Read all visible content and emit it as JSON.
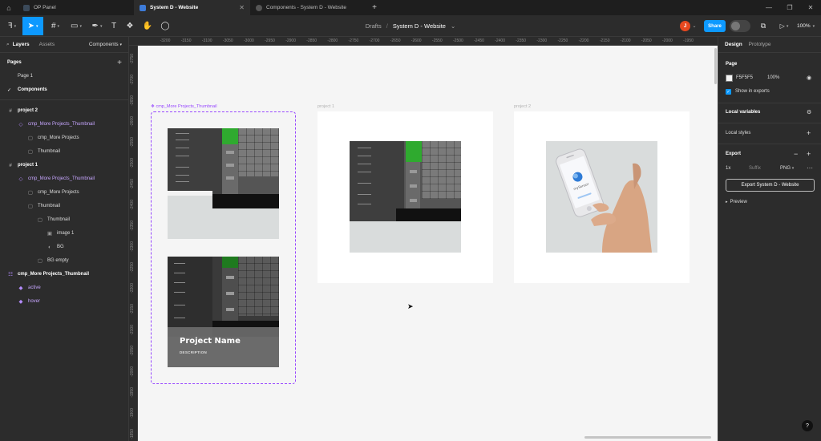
{
  "tabs": [
    {
      "label": "OP Panel",
      "active": false
    },
    {
      "label": "System D - Website",
      "active": true
    },
    {
      "label": "Components - System D - Website",
      "active": false
    }
  ],
  "window_controls": {
    "minimize": "—",
    "restore": "❐",
    "close": "✕"
  },
  "toolbar": {
    "breadcrumb_parent": "Drafts",
    "breadcrumb_sep": "/",
    "file_name": "System D - Website",
    "avatar_initial": "J",
    "share_label": "Share",
    "zoom_level": "100%"
  },
  "left_panel": {
    "tab_layers": "Layers",
    "tab_assets": "Assets",
    "components_dropdown": "Components",
    "pages_heading": "Pages",
    "add_icon": "+",
    "pages": [
      "Page 1",
      "Components"
    ],
    "current_page_check": "✓",
    "layers": [
      {
        "label": "project 2",
        "icon": "#",
        "type": "frame"
      },
      {
        "label": "cmp_More Projects_Thumbnail",
        "icon": "◇",
        "type": "instance"
      },
      {
        "label": "cmp_More Projects",
        "icon": "▢",
        "type": "group"
      },
      {
        "label": "Thumbnail",
        "icon": "▢",
        "type": "group"
      },
      {
        "label": "project 1",
        "icon": "#",
        "type": "frame"
      },
      {
        "label": "cmp_More Projects_Thumbnail",
        "icon": "◇",
        "type": "instance"
      },
      {
        "label": "cmp_More Projects",
        "icon": "▢",
        "type": "group"
      },
      {
        "label": "Thumbnail",
        "icon": "▢",
        "type": "group"
      },
      {
        "label": "Thumbnail",
        "icon": "▢",
        "type": "group"
      },
      {
        "label": "image 1",
        "icon": "▣",
        "type": "image"
      },
      {
        "label": "BG",
        "icon": "◐",
        "type": "shape"
      },
      {
        "label": "BG empty",
        "icon": "▢",
        "type": "group"
      },
      {
        "label": "cmp_More Projects_Thumbnail",
        "icon": "☷",
        "type": "component-set"
      },
      {
        "label": "active",
        "icon": "◆",
        "type": "variant"
      },
      {
        "label": "hover",
        "icon": "◆",
        "type": "variant"
      }
    ]
  },
  "canvas": {
    "ruler_x": [
      "-3200",
      "-3150",
      "-3100",
      "-3050",
      "-3000",
      "-2950",
      "-2900",
      "-2850",
      "-2800",
      "-2750",
      "-2700",
      "-2650",
      "-2600",
      "-2550",
      "-2500",
      "-2450",
      "-2400",
      "-2350",
      "-2300",
      "-2250",
      "-2200",
      "-2150",
      "-2100",
      "-2050",
      "-2000",
      "-1950"
    ],
    "ruler_y": [
      "-2750",
      "-2700",
      "-2650",
      "-2600",
      "-2550",
      "-2500",
      "-2450",
      "-2400",
      "-2350",
      "-2300",
      "-2250",
      "-2200",
      "-2150",
      "-2100",
      "-2050",
      "-2000",
      "-1950",
      "-1900",
      "-1850"
    ],
    "component_set_label": "cmp_More Projects_Thumbnail",
    "frame_project1_label": "project 1",
    "frame_project2_label": "project 2",
    "project_name": "Project Name",
    "project_description": "DESCRIPTION",
    "phone_brand": "mySensor"
  },
  "right_panel": {
    "tab_design": "Design",
    "tab_prototype": "Prototype",
    "page_heading": "Page",
    "bg_color_hex": "F5F5F5",
    "bg_opacity": "100%",
    "show_in_exports": "Show in exports",
    "local_variables": "Local variables",
    "local_styles": "Local styles",
    "export_heading": "Export",
    "export_scale": "1x",
    "export_suffix_placeholder": "Suffix",
    "export_format": "PNG",
    "export_button": "Export System D - Website",
    "preview_label": "Preview",
    "help": "?"
  },
  "colors": {
    "accent": "#0d99ff",
    "component": "#9747ff",
    "canvas": "#f5f5f5",
    "avatar": "#e8481f"
  }
}
